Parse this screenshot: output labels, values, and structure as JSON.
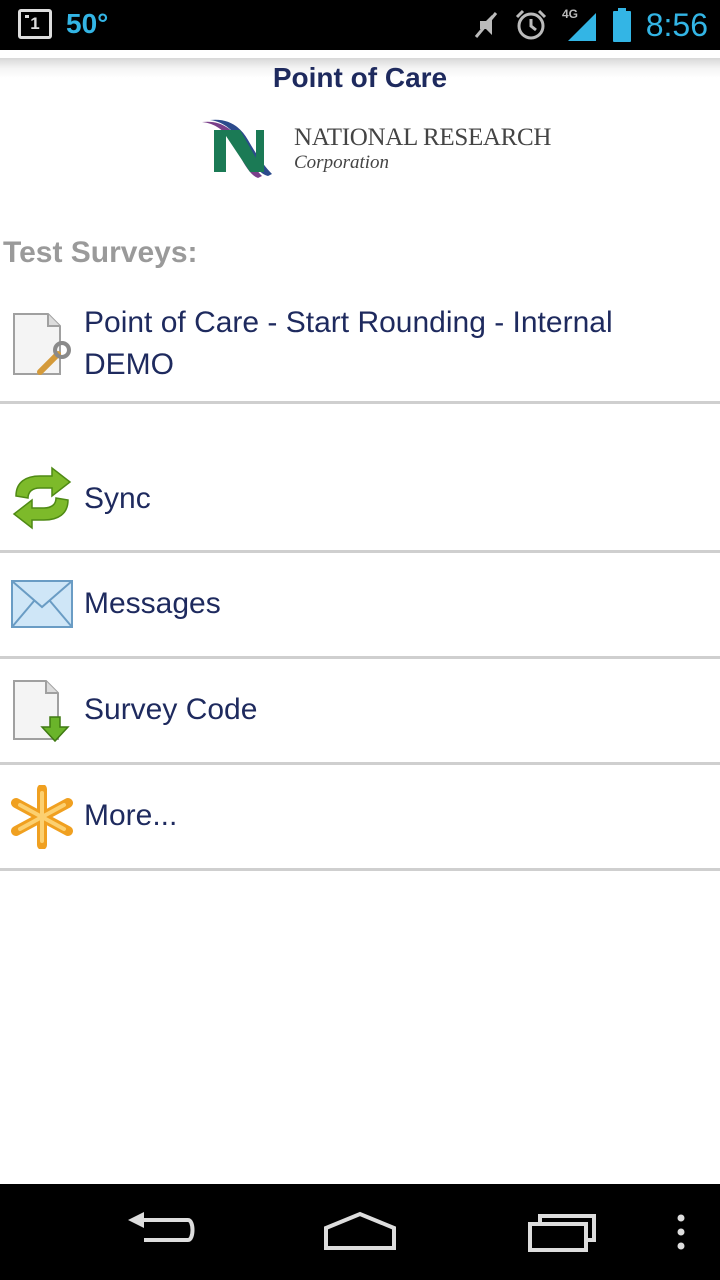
{
  "status_bar": {
    "notification_count": "1",
    "temperature": "50°",
    "network_type": "4G",
    "time": "8:56",
    "icons": [
      "notification-icon",
      "mute-icon",
      "alarm-icon",
      "signal-icon",
      "battery-icon"
    ]
  },
  "header": {
    "title": "Point of Care",
    "logo": {
      "name": "NATIONAL RESEARCH",
      "sub": "Corporation"
    }
  },
  "section_label": "Test Surveys:",
  "surveys": [
    {
      "label_line1": "Point of Care - Start Rounding - Internal",
      "label_line2": "DEMO",
      "icon": "survey-document-icon"
    }
  ],
  "menu": [
    {
      "label": "Sync",
      "icon": "sync-icon"
    },
    {
      "label": "Messages",
      "icon": "envelope-icon"
    },
    {
      "label": "Survey Code",
      "icon": "document-download-icon"
    },
    {
      "label": "More...",
      "icon": "asterisk-icon"
    }
  ],
  "nav_bar": {
    "buttons": [
      "back-button",
      "home-button",
      "recent-apps-button",
      "menu-button"
    ]
  },
  "colors": {
    "title": "#1e2a5e",
    "status_accent": "#33b5e5",
    "divider": "#cfcfcf",
    "section_label": "#9a9a9a"
  }
}
